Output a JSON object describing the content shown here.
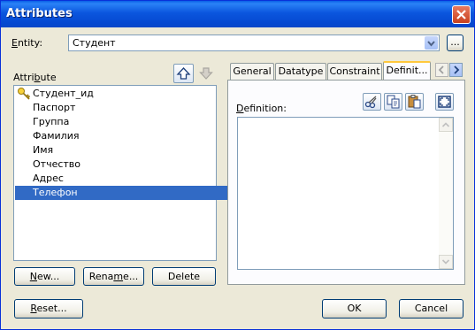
{
  "window": {
    "title": "Attributes"
  },
  "entity": {
    "label_underlined": "E",
    "label_rest": "ntity:",
    "value": "Студент",
    "browse_label": "..."
  },
  "attribute": {
    "label_start": "Attri",
    "label_underlined": "b",
    "label_end": "ute"
  },
  "attributes": [
    {
      "name": "Студент_ид",
      "is_key": true
    },
    {
      "name": "Паспорт"
    },
    {
      "name": "Группа"
    },
    {
      "name": "Фамилия"
    },
    {
      "name": "Имя"
    },
    {
      "name": "Отчество"
    },
    {
      "name": "Адрес"
    },
    {
      "name": "Телефон",
      "selected": true
    }
  ],
  "buttons": {
    "new_underlined": "N",
    "new_rest": "ew...",
    "rename_start": "Rena",
    "rename_underlined": "m",
    "rename_end": "e...",
    "delete": "Delete",
    "reset_underlined": "R",
    "reset_rest": "eset...",
    "ok": "OK",
    "cancel": "Cancel"
  },
  "tabs": [
    "General",
    "Datatype",
    "Constraint",
    "Definit..."
  ],
  "active_tab": "Definit...",
  "definition": {
    "label_underlined": "D",
    "label_rest": "efinition:",
    "value": ""
  },
  "icons": {
    "close": "close-icon",
    "key": "key-icon",
    "move_up": "arrow-up-icon",
    "move_down": "arrow-down-icon"
  },
  "colors": {
    "title_bar": "#0a5fe6",
    "selection": "#316ac5",
    "close_button": "#d6512f"
  }
}
